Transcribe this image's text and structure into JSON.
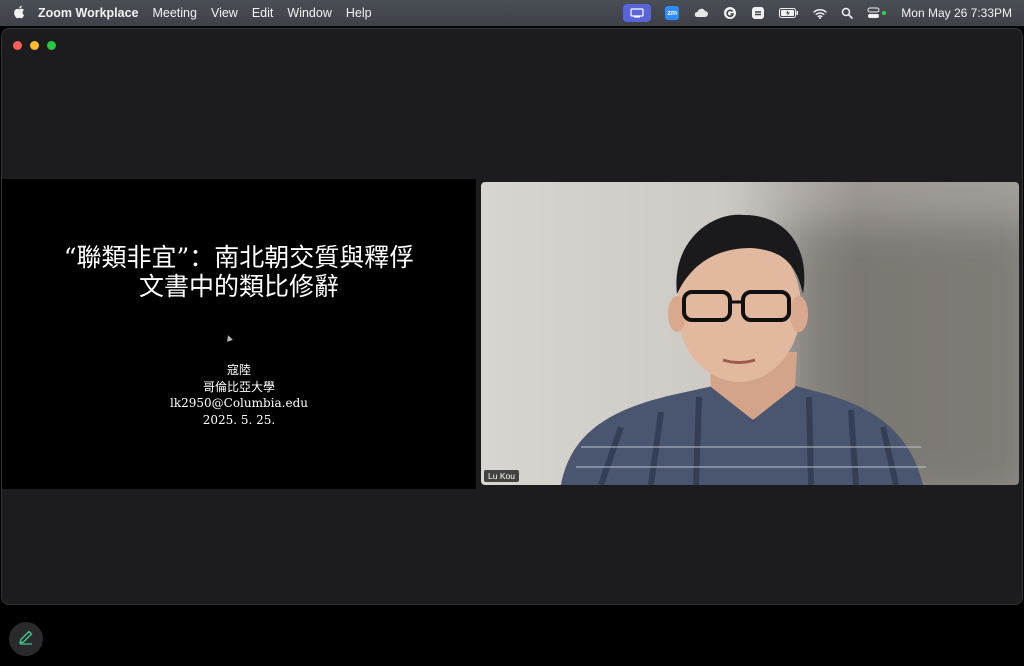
{
  "menubar": {
    "app_name": "Zoom Workplace",
    "items": [
      "Meeting",
      "View",
      "Edit",
      "Window",
      "Help"
    ],
    "icons": [
      "screen-share-status-icon",
      "zoom-icon",
      "cloud-icon",
      "grammarly-icon",
      "sync-icon",
      "battery-icon",
      "wifi-icon",
      "search-icon",
      "control-center-icon"
    ],
    "zoom_icon_text": "zm",
    "clock": "Mon May 26  7:33PM"
  },
  "slide": {
    "title_line1": "“聯類非宜”：南北朝交質與釋俘",
    "title_line2": "文書中的類比修辭",
    "author": "寇陸",
    "affiliation": "哥倫比亞大學",
    "email": "lk2950@Columbia.edu",
    "date": "2025. 5. 25."
  },
  "participant": {
    "name": "Lu Kou"
  },
  "colors": {
    "menubar": "#43474d",
    "window": "#1c1c1e",
    "slide_bg": "#000000",
    "accent": "#5864d8",
    "annotate_icon": "#3fc08a"
  }
}
